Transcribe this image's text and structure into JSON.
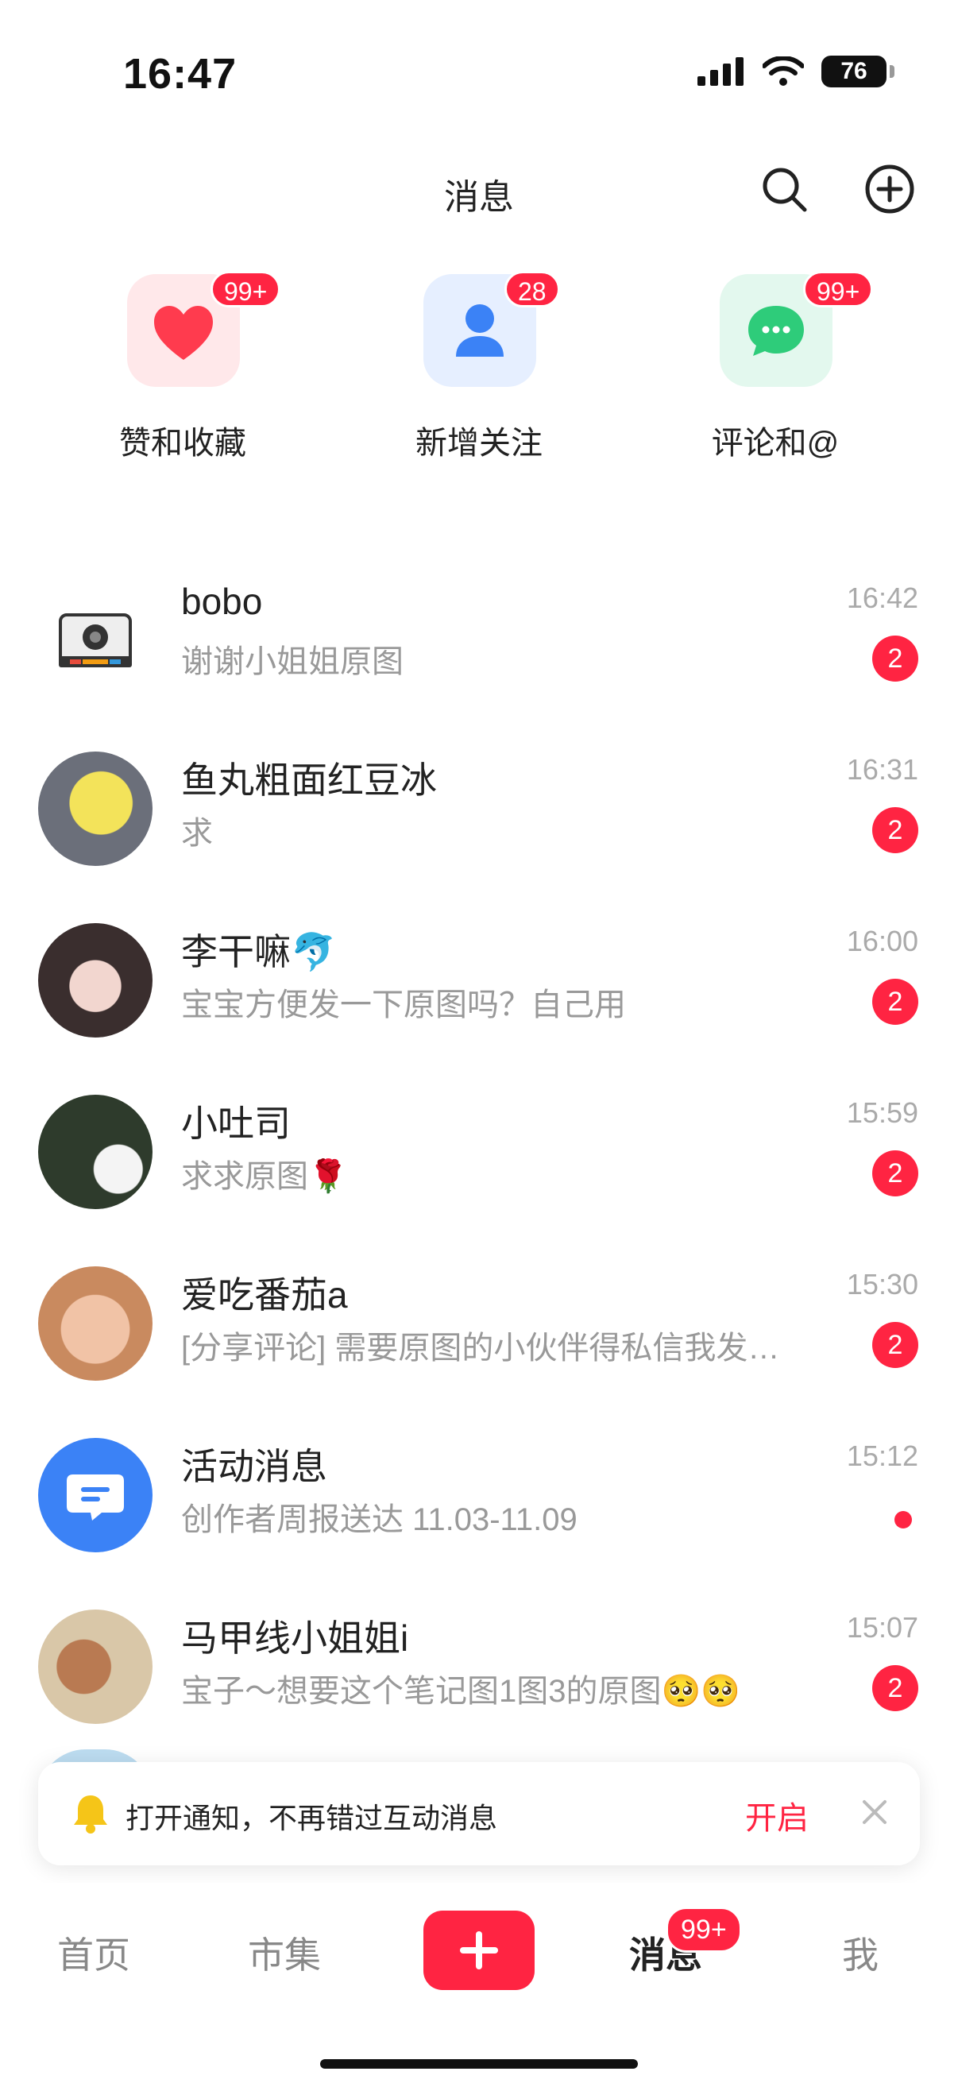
{
  "status": {
    "time": "16:47",
    "battery": "76"
  },
  "header": {
    "title": "消息"
  },
  "shortcuts": [
    {
      "label": "赞和收藏",
      "badge": "99+"
    },
    {
      "label": "新增关注",
      "badge": "28"
    },
    {
      "label": "评论和@",
      "badge": "99+"
    }
  ],
  "messages": [
    {
      "name": "bobo",
      "preview": "谢谢小姐姐原图",
      "time": "16:42",
      "count": "2"
    },
    {
      "name": "鱼丸粗面红豆冰",
      "preview": "求",
      "time": "16:31",
      "count": "2"
    },
    {
      "name": "李干嘛🐬",
      "preview": "宝宝方便发一下原图吗？自己用",
      "time": "16:00",
      "count": "2"
    },
    {
      "name": "小吐司",
      "preview": "求求原图🌹",
      "time": "15:59",
      "count": "2"
    },
    {
      "name": "爱吃番茄a",
      "preview": "[分享评论] 需要原图的小伙伴得私信我发…",
      "time": "15:30",
      "count": "2"
    },
    {
      "name": "活动消息",
      "preview": "创作者周报送达 11.03-11.09",
      "time": "15:12",
      "count": ""
    },
    {
      "name": "马甲线小姐姐i",
      "preview": "宝子～想要这个笔记图1图3的原图🥺🥺",
      "time": "15:07",
      "count": "2"
    }
  ],
  "notification": {
    "text": "打开通知，不再错过互动消息",
    "action": "开启"
  },
  "nav": {
    "home": "首页",
    "market": "市集",
    "messages": "消息",
    "messages_badge": "99+",
    "me": "我"
  },
  "colors": {
    "accent": "#ff2442"
  }
}
